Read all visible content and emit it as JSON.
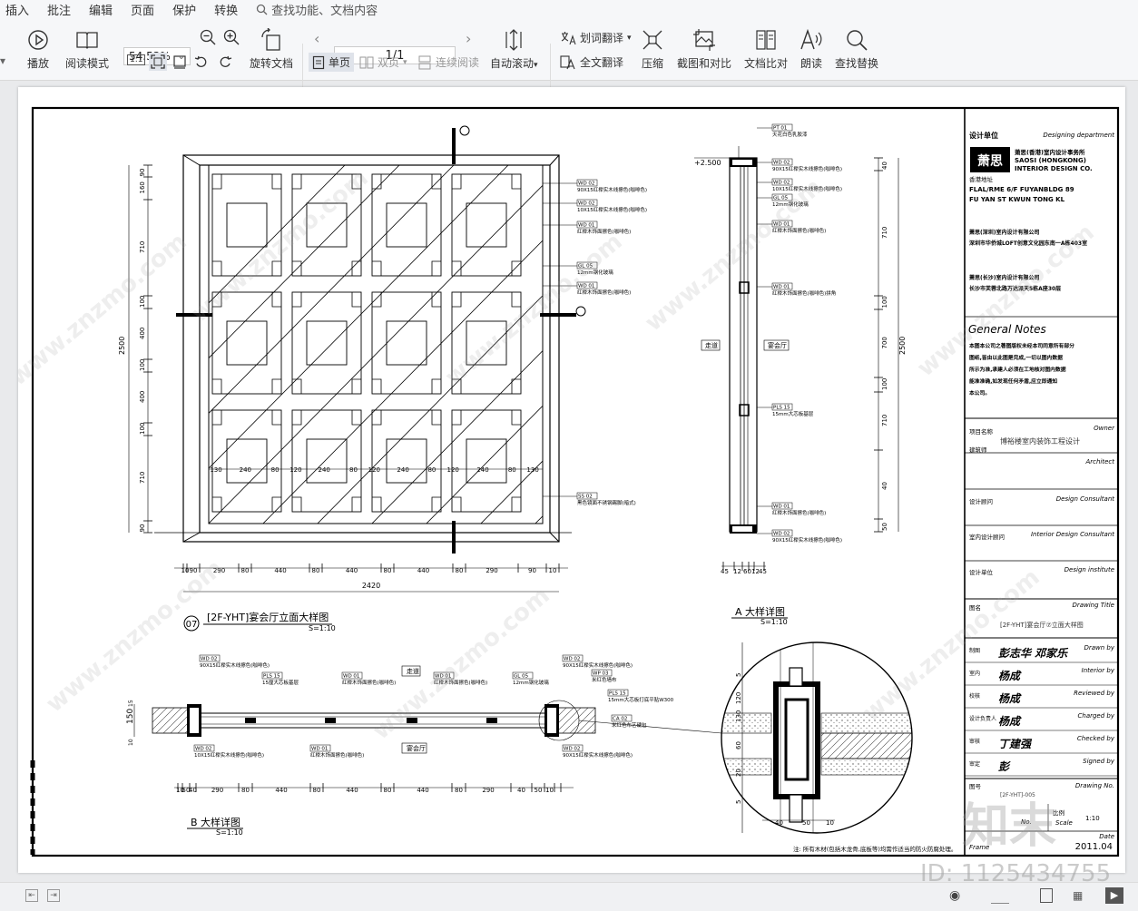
{
  "menu": {
    "items": [
      "插入",
      "批注",
      "编辑",
      "页面",
      "保护",
      "转换"
    ],
    "search_placeholder": "查找功能、文档内容"
  },
  "toolbar": {
    "play": "播放",
    "read_mode": "阅读模式",
    "zoom": "54.53%",
    "rotate": "旋转文档",
    "page_indicator": "1/1",
    "auto_scroll": "自动滚动",
    "single_page": "单页",
    "double_page": "双页",
    "continuous": "连续阅读",
    "word_translate": "划词翻译",
    "full_translate": "全文翻译",
    "compress": "压缩",
    "screenshot_compare": "截图和对比",
    "doc_compare": "文档比对",
    "read_aloud": "朗读",
    "find_replace": "查找替换",
    "fit_btn": "1:1"
  },
  "drawing": {
    "main_title": "[2F-YHT]宴会厅立面大样图",
    "main_num": "07",
    "main_scale": "S=1:10",
    "a_title": "A 大样详图",
    "a_scale": "S=1:10",
    "b_title": "B 大样详图",
    "b_scale": "S=1:10",
    "top_dims_left": [
      "90",
      "160",
      "710",
      "100",
      "400",
      "100",
      "400",
      "100",
      "710",
      "90"
    ],
    "total_height": "2500",
    "bottom_dims": [
      "10",
      "90",
      "290",
      "80",
      "440",
      "80",
      "440",
      "80",
      "440",
      "80",
      "290",
      "90",
      "10"
    ],
    "total_width": "2420",
    "inner_dims": [
      "130",
      "240",
      "80",
      "120",
      "240",
      "80",
      "120",
      "240",
      "80",
      "120",
      "240",
      "80",
      "130"
    ],
    "level_mark": "+2.500",
    "a_bottom_dims": [
      "45",
      "12",
      "60",
      "12",
      "45"
    ],
    "b_bottom_dims": [
      "10",
      "50",
      "40",
      "290",
      "80",
      "440",
      "80",
      "440",
      "80",
      "440",
      "80",
      "290",
      "40",
      "50",
      "10"
    ],
    "b_side_dims": [
      "15",
      "150",
      "10"
    ],
    "detail_dims_v": [
      "5",
      "120",
      "130",
      "60",
      "20",
      "5"
    ],
    "detail_dims_h": [
      "40",
      "50",
      "10"
    ],
    "labels_main": [
      {
        "code": "WD 02",
        "text": "90X15红榉实木线擦色(咖啡色)"
      },
      {
        "code": "WD 02",
        "text": "10X15红榉实木线擦色(咖啡色)"
      },
      {
        "code": "WD 01",
        "text": "红榉木饰面擦色(咖啡色)"
      },
      {
        "code": "GL 05",
        "text": "12mm钢化玻璃"
      },
      {
        "code": "WD 01",
        "text": "红榉木饰面擦色(咖啡色)"
      },
      {
        "code": "SS 02",
        "text": "黑色镜面不锈钢踢脚(暗式)"
      }
    ],
    "labels_a": [
      {
        "code": "PT 01",
        "text": "天花白色乳胶漆"
      },
      {
        "code": "WD 02",
        "text": "90X15红榉实木线擦色(咖啡色)"
      },
      {
        "code": "WD 02",
        "text": "10X15红榉实木线擦色(咖啡色)"
      },
      {
        "code": "GL 05",
        "text": "12mm钢化玻璃"
      },
      {
        "code": "WD 01",
        "text": "红榉木饰面擦色(咖啡色)"
      },
      {
        "code": "WD 01",
        "text": "红榉木饰面擦色(咖啡色)拼角"
      },
      {
        "code": "PLS 15",
        "text": "15mm大芯板基层"
      },
      {
        "code": "WD 01",
        "text": "红榉木饰面擦色(咖啡色)"
      },
      {
        "code": "WD 02",
        "text": "90X15红榉实木线擦色(咖啡色)"
      }
    ],
    "a_room_left": "走道",
    "a_room_right": "宴会厅",
    "b_room_top": "走道",
    "b_room_bottom": "宴会厅",
    "labels_b_top": [
      {
        "code": "WD 02",
        "text": "90X15红榉实木线擦色(咖啡色)"
      },
      {
        "code": "PLS 15",
        "text": "15厘大芯板基层"
      },
      {
        "code": "WD 01",
        "text": "红榉木饰面擦色(咖啡色)"
      },
      {
        "code": "WD 01",
        "text": "红榉木饰面擦色(咖啡色)"
      },
      {
        "code": "GL 05",
        "text": "12mm钢化玻璃"
      },
      {
        "code": "WD 02",
        "text": "90X15红榉实木线擦色(咖啡色)"
      },
      {
        "code": "WP 03",
        "text": "米红色墙布"
      },
      {
        "code": "PLS 15",
        "text": "15mm大芯板打底平贴W300"
      },
      {
        "code": "CA 02",
        "text": "米红色布艺硬包"
      }
    ],
    "labels_b_bottom": [
      {
        "code": "WD 02",
        "text": "10X15红榉实木线擦色(咖啡色)"
      },
      {
        "code": "WD 01",
        "text": "红榉木饰面擦色(咖啡色)"
      },
      {
        "code": "WD 02",
        "text": "90X15红榉实木线擦色(咖啡色)"
      }
    ],
    "footnote": "注: 所有木材(包括木龙骨,底板等)均需作适当的防火防腐处理。"
  },
  "titleblock": {
    "design_unit_cn": "设计单位",
    "design_unit_en": "Designing department",
    "company_cn": "萧思(香港)室内设计事务所",
    "company_en1": "SAOSI (HONGKONG)",
    "company_en2": "INTERIOR DESIGN CO.",
    "hk_addr_label": "香港地址",
    "hk_addr1": "FLAL/RME 6/F FUYANBLDG 89",
    "hk_addr2": "FU YAN ST KWUN TONG  KL",
    "sz_company": "萧思(深圳)室内设计有限公司",
    "sz_addr": "深圳市华侨城LOFT创意文化园东南一A栋403室",
    "cs_company": "萧思(长沙)室内设计有限公司",
    "cs_addr": "长沙市芙蓉北路万达派天5栋A座30层",
    "notes_title": "General  Notes",
    "notes": [
      "本图本公司之著图版权未经本司同意所有部分",
      "图纸,皆由以此图是完成,一切以图内数据",
      "所示为准,承建人必须在工地核对图内数据",
      "能准准确,如发现任何矛盾,应立即通知",
      "本公司。"
    ],
    "owner_label": "项目名称",
    "owner_en": "Owner",
    "project": "博裕楼室内装饰工程设计",
    "architect_label": "建筑师",
    "architect_en": "Architect",
    "consultant_label": "设计顾问",
    "consultant_en": "Design Consultant",
    "interior_label": "室内设计顾问",
    "interior_en": "Interior Design Consultant",
    "institute_label": "设计单位",
    "institute_en": "Design institute",
    "drawing_title_label": "图名",
    "drawing_title_en": "Drawing Title",
    "drawing_title": "[2F-YHT]宴会厅⑦立面大样图",
    "rows": [
      {
        "cn": "制图",
        "en": "Drawn by",
        "sig": "彭志华 邓家乐"
      },
      {
        "cn": "室内",
        "en": "Interior by",
        "sig": "杨成"
      },
      {
        "cn": "校核",
        "en": "Reviewed by",
        "sig": "杨成"
      },
      {
        "cn": "设计负责人",
        "en": "Charged by",
        "sig": "杨成"
      },
      {
        "cn": "审核",
        "en": "Checked by",
        "sig": "丁建强"
      },
      {
        "cn": "审定",
        "en": "Signed by",
        "sig": "彭"
      }
    ],
    "drawing_no_label": "图号",
    "drawing_no_en": "Drawing No.",
    "drawing_no": "[2F-YHT]-005",
    "scale_label": "比例",
    "scale_en": "Scale",
    "scale": "1:10",
    "no_label": "No.",
    "frame_label": "Frame",
    "date_label": "Date",
    "date": "2011.04"
  },
  "watermark": {
    "site": "www.znzmo.com",
    "brand": "知末",
    "id": "ID: 1125434755"
  }
}
